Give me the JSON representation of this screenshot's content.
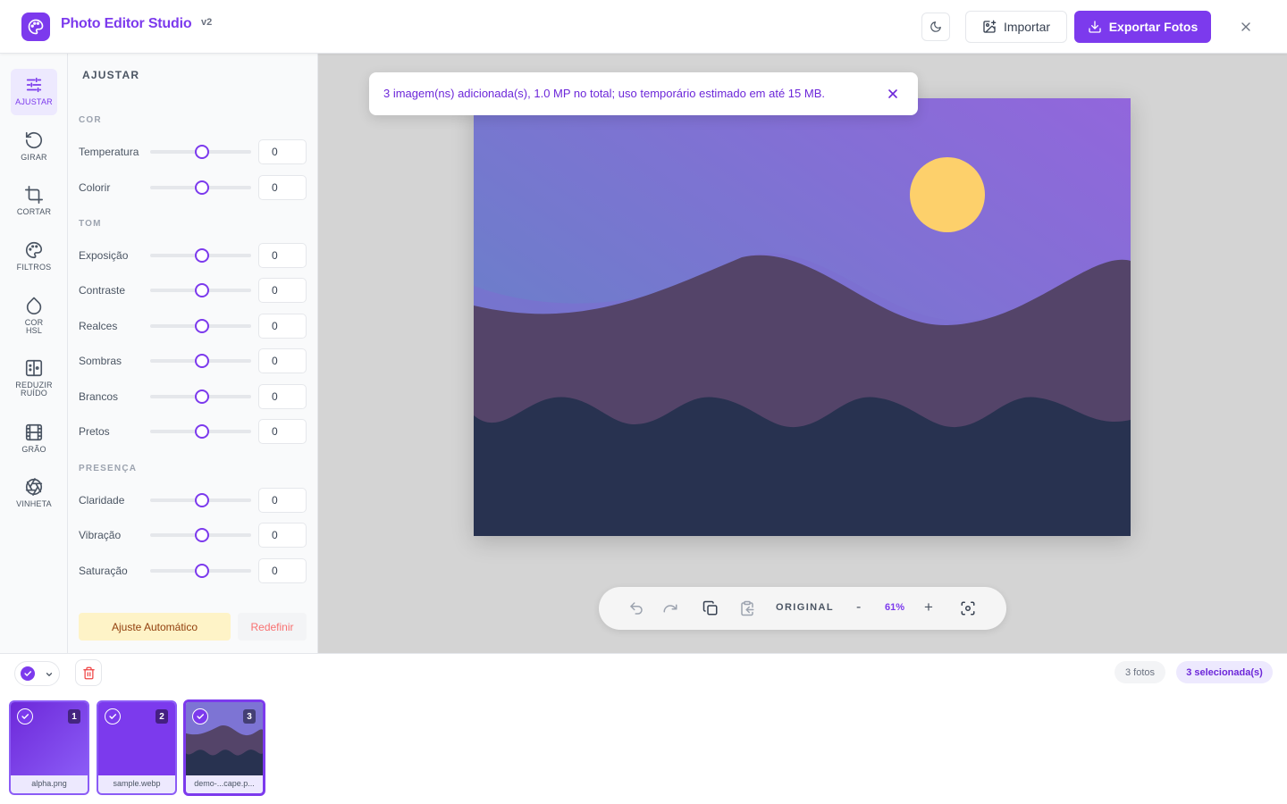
{
  "app": {
    "title": "Photo Editor Studio",
    "version": "v2",
    "brand_color": "#7c3aed"
  },
  "header": {
    "import_label": "Importar",
    "export_label": "Exportar Fotos"
  },
  "tools": [
    {
      "label": "AJUSTAR",
      "icon": "sliders-icon",
      "active": true
    },
    {
      "label": "GIRAR",
      "icon": "rotate-icon",
      "active": false
    },
    {
      "label": "CORTAR",
      "icon": "crop-icon",
      "active": false
    },
    {
      "label": "FILTROS",
      "icon": "palette-icon",
      "active": false
    },
    {
      "label": "COR HSL",
      "icon": "droplet-icon",
      "active": false
    },
    {
      "label": "REDUZIR RUÍDO",
      "icon": "denoise-icon",
      "active": false
    },
    {
      "label": "GRÃO",
      "icon": "film-icon",
      "active": false
    },
    {
      "label": "VINHETA",
      "icon": "aperture-icon",
      "active": false
    }
  ],
  "panel": {
    "title": "AJUSTAR",
    "sections": [
      {
        "title": "COR",
        "sliders": [
          {
            "label": "Temperatura",
            "value": "0"
          },
          {
            "label": "Colorir",
            "value": "0"
          }
        ]
      },
      {
        "title": "TOM",
        "sliders": [
          {
            "label": "Exposição",
            "value": "0"
          },
          {
            "label": "Contraste",
            "value": "0"
          },
          {
            "label": "Realces",
            "value": "0"
          },
          {
            "label": "Sombras",
            "value": "0"
          },
          {
            "label": "Brancos",
            "value": "0"
          },
          {
            "label": "Pretos",
            "value": "0"
          }
        ]
      },
      {
        "title": "PRESENÇA",
        "sliders": [
          {
            "label": "Claridade",
            "value": "0"
          },
          {
            "label": "Vibração",
            "value": "0"
          },
          {
            "label": "Saturação",
            "value": "0"
          }
        ]
      }
    ],
    "auto_label": "Ajuste Automático",
    "reset_label": "Redefinir"
  },
  "toast": {
    "message": "3 imagem(ns) adicionada(s), 1.0 MP no total; uso temporário estimado em até 15 MB."
  },
  "zoombar": {
    "original_label": "ORIGINAL",
    "zoom_level": "61%",
    "minus": "-",
    "plus": "+"
  },
  "strip": {
    "count_label": "3 fotos",
    "selected_label": "3 selecionada(s)",
    "thumbnails": [
      {
        "number": "1",
        "name": "alpha.png",
        "selected": true
      },
      {
        "number": "2",
        "name": "sample.webp",
        "selected": true
      },
      {
        "number": "3",
        "name": "demo-...cape.p...",
        "selected": true,
        "current": true
      }
    ]
  }
}
